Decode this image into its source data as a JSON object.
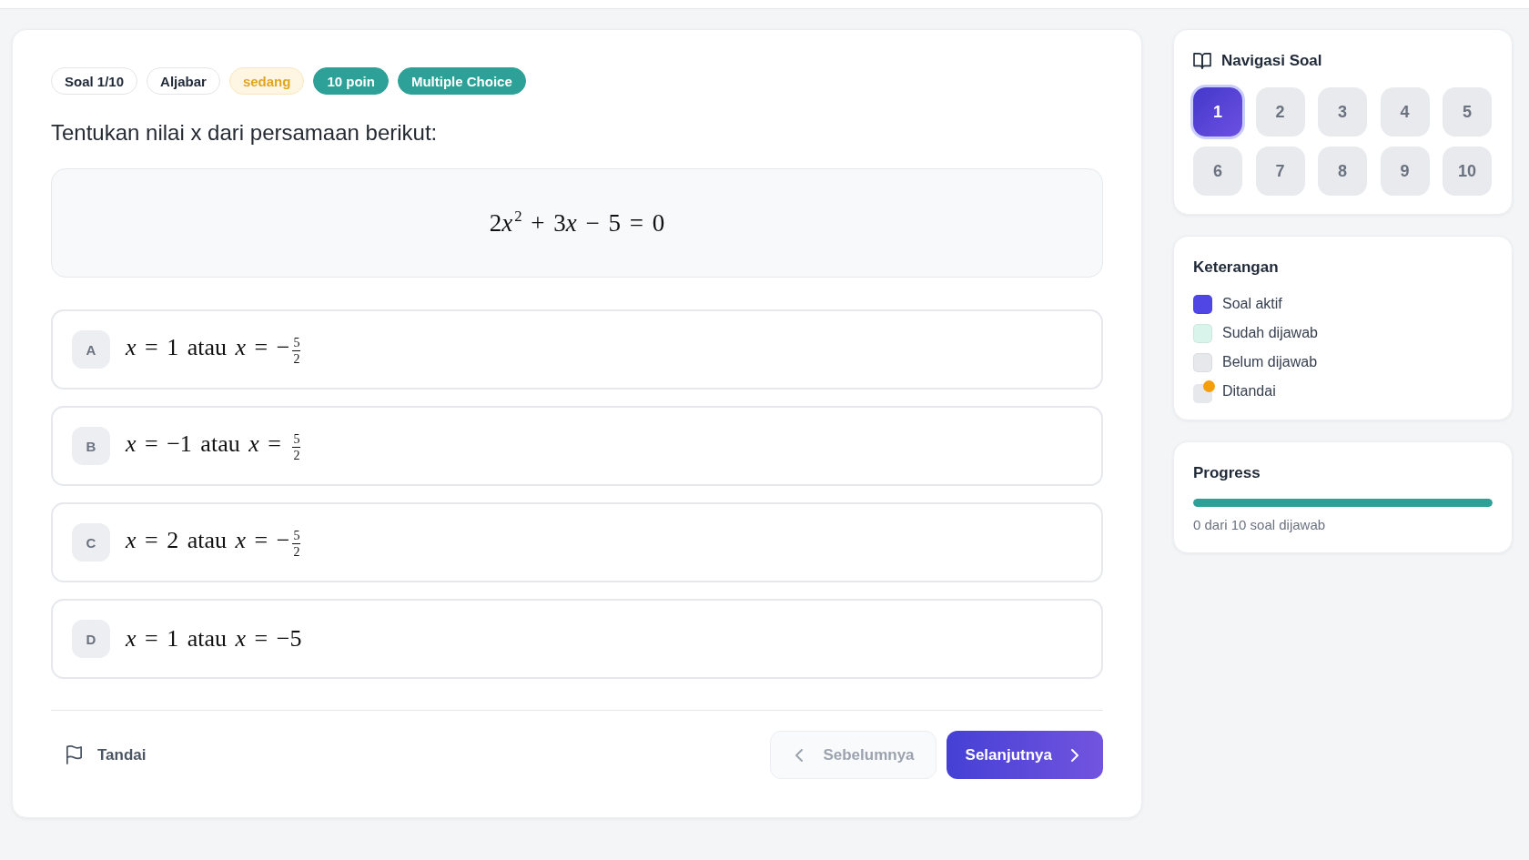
{
  "question": {
    "tags": [
      {
        "label": "Soal 1/10",
        "kind": "outline"
      },
      {
        "label": "Aljabar",
        "kind": "outline"
      },
      {
        "label": "sedang",
        "kind": "difficulty"
      },
      {
        "label": "10 poin",
        "kind": "solid"
      },
      {
        "label": "Multiple Choice",
        "kind": "solid"
      }
    ],
    "prompt": "Tentukan nilai x dari persamaan berikut:",
    "equation": [
      {
        "kind": "number",
        "text": "2"
      },
      {
        "kind": "variable",
        "text": "x$^{2}$"
      },
      {
        "kind": "operator",
        "text": "+"
      },
      {
        "kind": "number",
        "text": "3"
      },
      {
        "kind": "variable",
        "text": "x"
      },
      {
        "kind": "operator",
        "text": "−"
      },
      {
        "kind": "number",
        "text": "5"
      },
      {
        "kind": "operator",
        "text": "="
      },
      {
        "kind": "number",
        "text": "0"
      }
    ],
    "options": [
      {
        "letter": "A",
        "text": "*x* = 1 atau *x* = −$^{5}$$_{2}$",
        "selected": false
      },
      {
        "letter": "B",
        "text": "*x* = −1 atau *x* = $^{5}$$_{2}$",
        "selected": false
      },
      {
        "letter": "C",
        "text": "*x* = 2 atau *x* = −$^{5}$$_{2}$",
        "selected": false
      },
      {
        "letter": "D",
        "text": "*x* = 1 atau *x* = −5",
        "selected": false
      }
    ]
  },
  "footer": {
    "flag_button": {
      "label": "Tandai"
    },
    "previous_button": {
      "label": "Sebelumnya",
      "disabled": true
    },
    "next_button": {
      "label": "Selanjutnya"
    }
  },
  "navigation": {
    "title": "Navigasi Soal",
    "items": [
      {
        "label": "1",
        "selected": true
      },
      {
        "label": "2",
        "selected": false
      },
      {
        "label": "3",
        "selected": false
      },
      {
        "label": "4",
        "selected": false
      },
      {
        "label": "5",
        "selected": false
      },
      {
        "label": "6",
        "selected": false
      },
      {
        "label": "7",
        "selected": false
      },
      {
        "label": "8",
        "selected": false
      },
      {
        "label": "9",
        "selected": false
      },
      {
        "label": "10",
        "selected": false
      }
    ]
  },
  "legend": {
    "title": "Keterangan",
    "items": [
      {
        "label": "Soal aktif",
        "kind": "swatch",
        "color": "#4f46e5"
      },
      {
        "label": "Sudah dijawab",
        "kind": "swatch",
        "color": "#d9f4ea"
      },
      {
        "label": "Belum dijawab",
        "kind": "swatch",
        "color": "#e6e8eb"
      },
      {
        "label": "Ditandai",
        "kind": "flagged",
        "color": "#f59e0b"
      }
    ]
  },
  "progress": {
    "title": "Progress",
    "level": 1,
    "caption": "0 dari 10 soal dijawab"
  }
}
